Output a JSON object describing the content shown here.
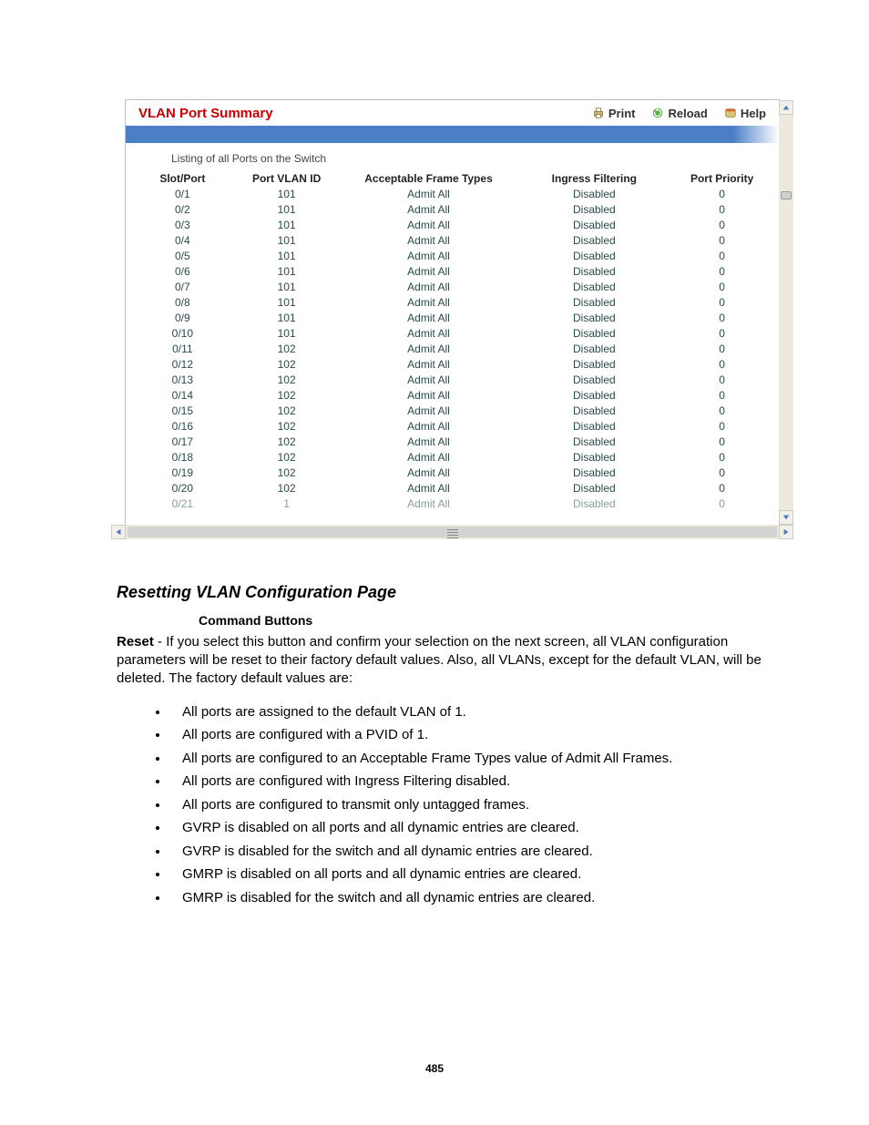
{
  "header": {
    "title": "VLAN Port Summary",
    "print": "Print",
    "reload": "Reload",
    "help": "Help"
  },
  "subtitle": "Listing of all Ports on the Switch",
  "columns": {
    "slot": "Slot/Port",
    "pvid": "Port VLAN ID",
    "frames": "Acceptable Frame Types",
    "ingress": "Ingress Filtering",
    "priority": "Port Priority"
  },
  "rows": [
    {
      "slot": "0/1",
      "pvid": "101",
      "frames": "Admit All",
      "ingress": "Disabled",
      "priority": "0"
    },
    {
      "slot": "0/2",
      "pvid": "101",
      "frames": "Admit All",
      "ingress": "Disabled",
      "priority": "0"
    },
    {
      "slot": "0/3",
      "pvid": "101",
      "frames": "Admit All",
      "ingress": "Disabled",
      "priority": "0"
    },
    {
      "slot": "0/4",
      "pvid": "101",
      "frames": "Admit All",
      "ingress": "Disabled",
      "priority": "0"
    },
    {
      "slot": "0/5",
      "pvid": "101",
      "frames": "Admit All",
      "ingress": "Disabled",
      "priority": "0"
    },
    {
      "slot": "0/6",
      "pvid": "101",
      "frames": "Admit All",
      "ingress": "Disabled",
      "priority": "0"
    },
    {
      "slot": "0/7",
      "pvid": "101",
      "frames": "Admit All",
      "ingress": "Disabled",
      "priority": "0"
    },
    {
      "slot": "0/8",
      "pvid": "101",
      "frames": "Admit All",
      "ingress": "Disabled",
      "priority": "0"
    },
    {
      "slot": "0/9",
      "pvid": "101",
      "frames": "Admit All",
      "ingress": "Disabled",
      "priority": "0"
    },
    {
      "slot": "0/10",
      "pvid": "101",
      "frames": "Admit All",
      "ingress": "Disabled",
      "priority": "0"
    },
    {
      "slot": "0/11",
      "pvid": "102",
      "frames": "Admit All",
      "ingress": "Disabled",
      "priority": "0"
    },
    {
      "slot": "0/12",
      "pvid": "102",
      "frames": "Admit All",
      "ingress": "Disabled",
      "priority": "0"
    },
    {
      "slot": "0/13",
      "pvid": "102",
      "frames": "Admit All",
      "ingress": "Disabled",
      "priority": "0"
    },
    {
      "slot": "0/14",
      "pvid": "102",
      "frames": "Admit All",
      "ingress": "Disabled",
      "priority": "0"
    },
    {
      "slot": "0/15",
      "pvid": "102",
      "frames": "Admit All",
      "ingress": "Disabled",
      "priority": "0"
    },
    {
      "slot": "0/16",
      "pvid": "102",
      "frames": "Admit All",
      "ingress": "Disabled",
      "priority": "0"
    },
    {
      "slot": "0/17",
      "pvid": "102",
      "frames": "Admit All",
      "ingress": "Disabled",
      "priority": "0"
    },
    {
      "slot": "0/18",
      "pvid": "102",
      "frames": "Admit All",
      "ingress": "Disabled",
      "priority": "0"
    },
    {
      "slot": "0/19",
      "pvid": "102",
      "frames": "Admit All",
      "ingress": "Disabled",
      "priority": "0"
    },
    {
      "slot": "0/20",
      "pvid": "102",
      "frames": "Admit All",
      "ingress": "Disabled",
      "priority": "0"
    }
  ],
  "partial_row": {
    "slot": "0/21",
    "pvid": "1",
    "frames": "Admit All",
    "ingress": "Disabled",
    "priority": "0"
  },
  "doc": {
    "title": "Resetting VLAN Configuration Page",
    "subheading": "Command Buttons",
    "para_lead": "Reset",
    "para_rest": " - If you select this button and confirm your selection on the next screen, all VLAN configuration parameters will be reset to their factory default values. Also, all VLANs, except for the default VLAN, will be deleted. The factory default values are:",
    "bullets": [
      "All ports are assigned to the default VLAN of 1.",
      "All ports are configured with a PVID of 1.",
      "All ports are configured to an Acceptable Frame Types value of Admit All Frames.",
      "All ports are configured with Ingress Filtering disabled.",
      "All ports are configured to transmit only untagged frames.",
      "GVRP is disabled on all ports and all dynamic entries are cleared.",
      "GVRP is disabled for the switch and all dynamic entries are cleared.",
      "GMRP is disabled on all ports and all dynamic entries are cleared.",
      "GMRP is disabled for the switch and all dynamic entries are cleared."
    ]
  },
  "footer": "485"
}
